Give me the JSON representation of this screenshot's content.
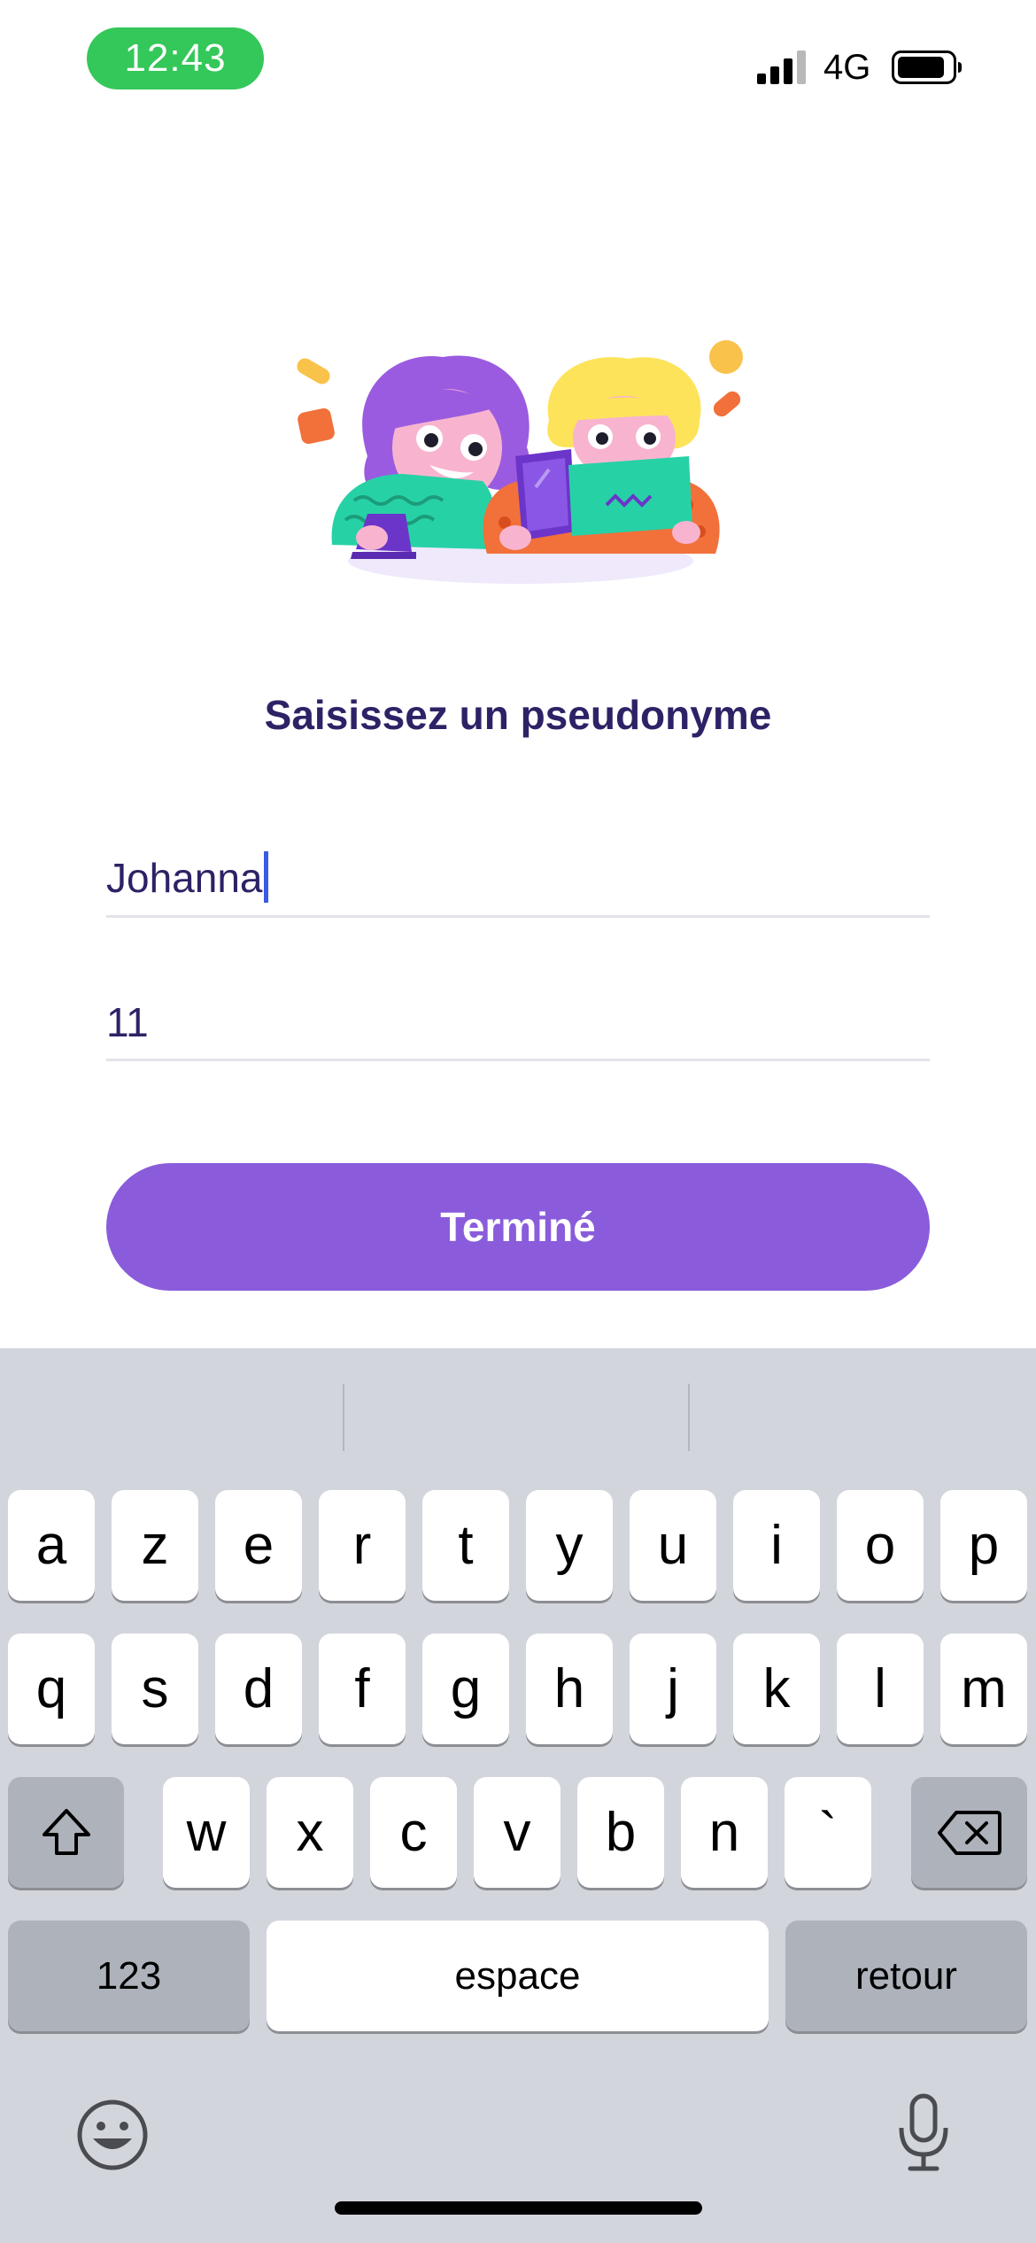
{
  "status_bar": {
    "time": "12:43",
    "network": "4G",
    "signal_icon": "cellular-signal-icon",
    "battery_icon": "battery-icon"
  },
  "illustration": {
    "icon": "kids-with-tablet-illustration"
  },
  "form": {
    "title": "Saisissez un pseudonyme",
    "pseudonym_value": "Johanna",
    "age_value": "11",
    "done_label": "Terminé"
  },
  "colors": {
    "accent": "#8a5cdb",
    "title_text": "#2e2266",
    "status_pill": "#34c759",
    "caret": "#3a5ae6"
  },
  "keyboard": {
    "row1": [
      "a",
      "z",
      "e",
      "r",
      "t",
      "y",
      "u",
      "i",
      "o",
      "p"
    ],
    "row2": [
      "q",
      "s",
      "d",
      "f",
      "g",
      "h",
      "j",
      "k",
      "l",
      "m"
    ],
    "row3": [
      "w",
      "x",
      "c",
      "v",
      "b",
      "n",
      "`"
    ],
    "numbers_label": "123",
    "space_label": "espace",
    "return_label": "retour",
    "shift_icon": "shift-icon",
    "delete_icon": "delete-icon",
    "emoji_icon": "emoji-icon",
    "mic_icon": "microphone-icon"
  }
}
